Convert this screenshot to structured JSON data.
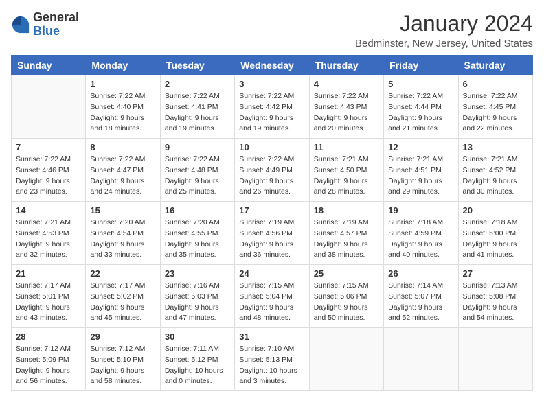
{
  "logo": {
    "general": "General",
    "blue": "Blue"
  },
  "header": {
    "title": "January 2024",
    "subtitle": "Bedminster, New Jersey, United States"
  },
  "days_of_week": [
    "Sunday",
    "Monday",
    "Tuesday",
    "Wednesday",
    "Thursday",
    "Friday",
    "Saturday"
  ],
  "weeks": [
    [
      {
        "day": "",
        "info": ""
      },
      {
        "day": "1",
        "info": "Sunrise: 7:22 AM\nSunset: 4:40 PM\nDaylight: 9 hours\nand 18 minutes."
      },
      {
        "day": "2",
        "info": "Sunrise: 7:22 AM\nSunset: 4:41 PM\nDaylight: 9 hours\nand 19 minutes."
      },
      {
        "day": "3",
        "info": "Sunrise: 7:22 AM\nSunset: 4:42 PM\nDaylight: 9 hours\nand 19 minutes."
      },
      {
        "day": "4",
        "info": "Sunrise: 7:22 AM\nSunset: 4:43 PM\nDaylight: 9 hours\nand 20 minutes."
      },
      {
        "day": "5",
        "info": "Sunrise: 7:22 AM\nSunset: 4:44 PM\nDaylight: 9 hours\nand 21 minutes."
      },
      {
        "day": "6",
        "info": "Sunrise: 7:22 AM\nSunset: 4:45 PM\nDaylight: 9 hours\nand 22 minutes."
      }
    ],
    [
      {
        "day": "7",
        "info": "Sunrise: 7:22 AM\nSunset: 4:46 PM\nDaylight: 9 hours\nand 23 minutes."
      },
      {
        "day": "8",
        "info": "Sunrise: 7:22 AM\nSunset: 4:47 PM\nDaylight: 9 hours\nand 24 minutes."
      },
      {
        "day": "9",
        "info": "Sunrise: 7:22 AM\nSunset: 4:48 PM\nDaylight: 9 hours\nand 25 minutes."
      },
      {
        "day": "10",
        "info": "Sunrise: 7:22 AM\nSunset: 4:49 PM\nDaylight: 9 hours\nand 26 minutes."
      },
      {
        "day": "11",
        "info": "Sunrise: 7:21 AM\nSunset: 4:50 PM\nDaylight: 9 hours\nand 28 minutes."
      },
      {
        "day": "12",
        "info": "Sunrise: 7:21 AM\nSunset: 4:51 PM\nDaylight: 9 hours\nand 29 minutes."
      },
      {
        "day": "13",
        "info": "Sunrise: 7:21 AM\nSunset: 4:52 PM\nDaylight: 9 hours\nand 30 minutes."
      }
    ],
    [
      {
        "day": "14",
        "info": "Sunrise: 7:21 AM\nSunset: 4:53 PM\nDaylight: 9 hours\nand 32 minutes."
      },
      {
        "day": "15",
        "info": "Sunrise: 7:20 AM\nSunset: 4:54 PM\nDaylight: 9 hours\nand 33 minutes."
      },
      {
        "day": "16",
        "info": "Sunrise: 7:20 AM\nSunset: 4:55 PM\nDaylight: 9 hours\nand 35 minutes."
      },
      {
        "day": "17",
        "info": "Sunrise: 7:19 AM\nSunset: 4:56 PM\nDaylight: 9 hours\nand 36 minutes."
      },
      {
        "day": "18",
        "info": "Sunrise: 7:19 AM\nSunset: 4:57 PM\nDaylight: 9 hours\nand 38 minutes."
      },
      {
        "day": "19",
        "info": "Sunrise: 7:18 AM\nSunset: 4:59 PM\nDaylight: 9 hours\nand 40 minutes."
      },
      {
        "day": "20",
        "info": "Sunrise: 7:18 AM\nSunset: 5:00 PM\nDaylight: 9 hours\nand 41 minutes."
      }
    ],
    [
      {
        "day": "21",
        "info": "Sunrise: 7:17 AM\nSunset: 5:01 PM\nDaylight: 9 hours\nand 43 minutes."
      },
      {
        "day": "22",
        "info": "Sunrise: 7:17 AM\nSunset: 5:02 PM\nDaylight: 9 hours\nand 45 minutes."
      },
      {
        "day": "23",
        "info": "Sunrise: 7:16 AM\nSunset: 5:03 PM\nDaylight: 9 hours\nand 47 minutes."
      },
      {
        "day": "24",
        "info": "Sunrise: 7:15 AM\nSunset: 5:04 PM\nDaylight: 9 hours\nand 48 minutes."
      },
      {
        "day": "25",
        "info": "Sunrise: 7:15 AM\nSunset: 5:06 PM\nDaylight: 9 hours\nand 50 minutes."
      },
      {
        "day": "26",
        "info": "Sunrise: 7:14 AM\nSunset: 5:07 PM\nDaylight: 9 hours\nand 52 minutes."
      },
      {
        "day": "27",
        "info": "Sunrise: 7:13 AM\nSunset: 5:08 PM\nDaylight: 9 hours\nand 54 minutes."
      }
    ],
    [
      {
        "day": "28",
        "info": "Sunrise: 7:12 AM\nSunset: 5:09 PM\nDaylight: 9 hours\nand 56 minutes."
      },
      {
        "day": "29",
        "info": "Sunrise: 7:12 AM\nSunset: 5:10 PM\nDaylight: 9 hours\nand 58 minutes."
      },
      {
        "day": "30",
        "info": "Sunrise: 7:11 AM\nSunset: 5:12 PM\nDaylight: 10 hours\nand 0 minutes."
      },
      {
        "day": "31",
        "info": "Sunrise: 7:10 AM\nSunset: 5:13 PM\nDaylight: 10 hours\nand 3 minutes."
      },
      {
        "day": "",
        "info": ""
      },
      {
        "day": "",
        "info": ""
      },
      {
        "day": "",
        "info": ""
      }
    ]
  ]
}
